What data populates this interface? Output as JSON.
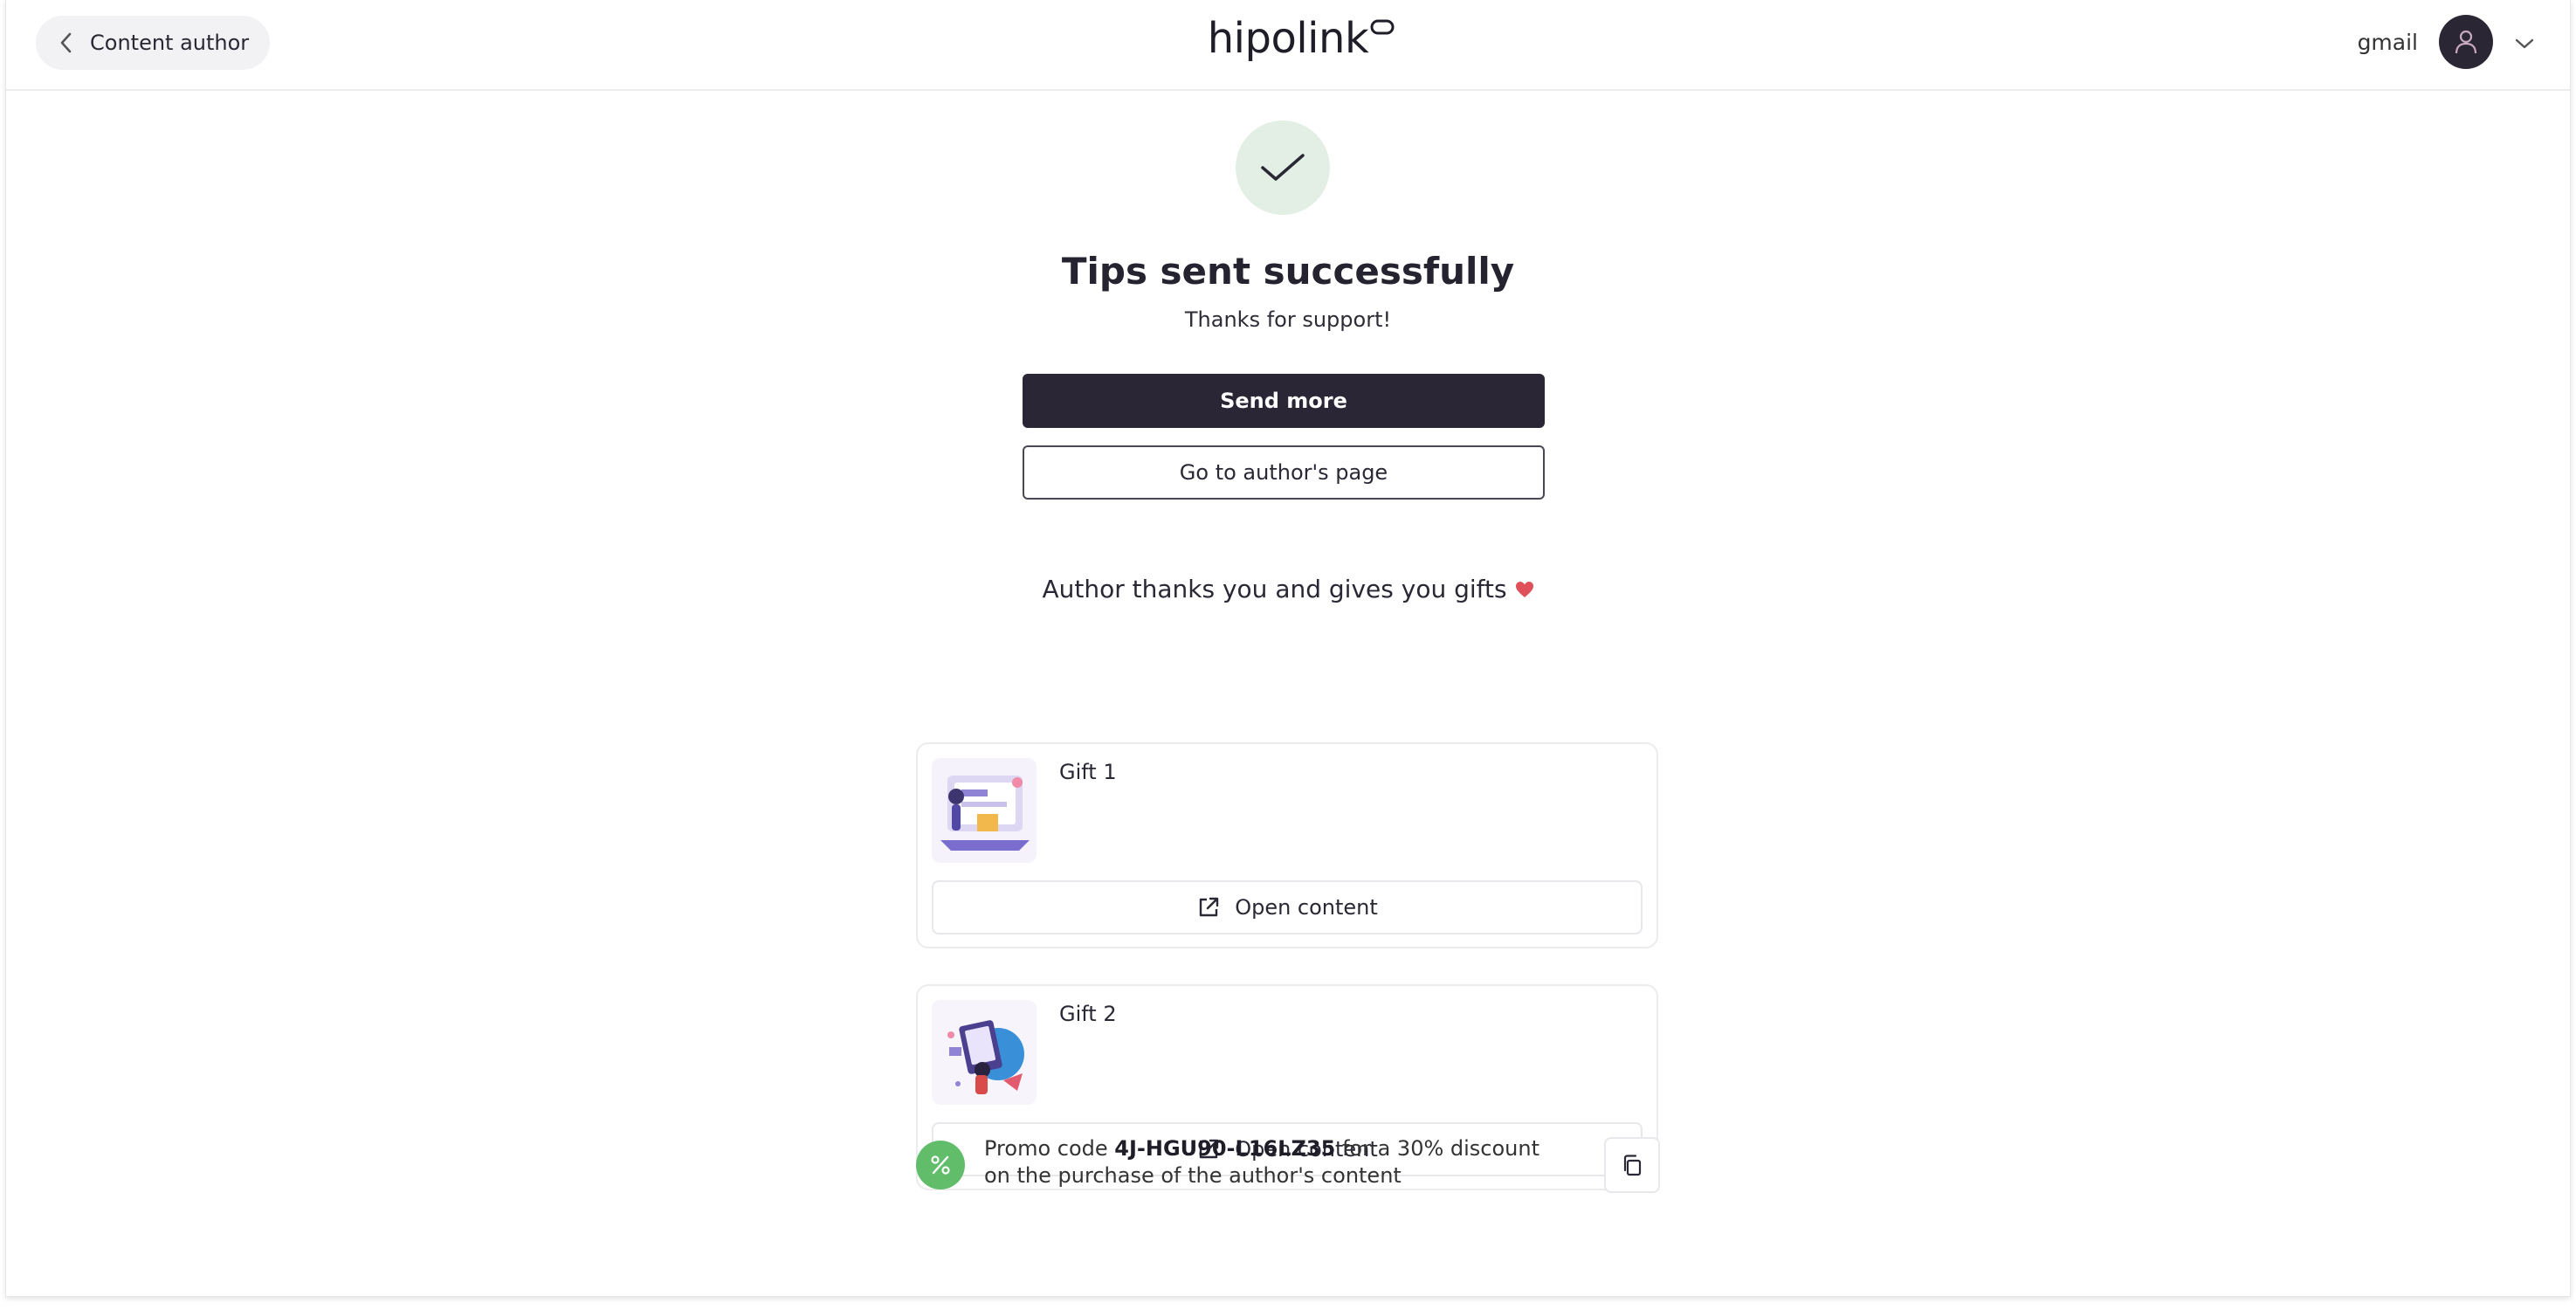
{
  "header": {
    "back_label": "Content author",
    "logo_text": "hipolink",
    "account_label": "gmail"
  },
  "result": {
    "title": "Tips sent successfully",
    "subtitle": "Thanks for support!",
    "send_more_label": "Send more",
    "author_page_label": "Go to author's page"
  },
  "gifts": {
    "heading": "Author thanks you and gives you gifts",
    "heart_icon": "heart-icon",
    "items": [
      {
        "name": "Gift 1",
        "open_label": "Open content"
      },
      {
        "name": "Gift 2",
        "open_label": "Open content"
      }
    ]
  },
  "promo": {
    "prefix": "Promo code",
    "code": "4J-HGU90-L16LZ35",
    "suffix": "for a 30% discount on the purchase of the author's content"
  },
  "colors": {
    "primary": "#2a2635",
    "success_bg": "#e3efe4",
    "promo_green": "#62bd6b",
    "heart": "#e0505a"
  }
}
